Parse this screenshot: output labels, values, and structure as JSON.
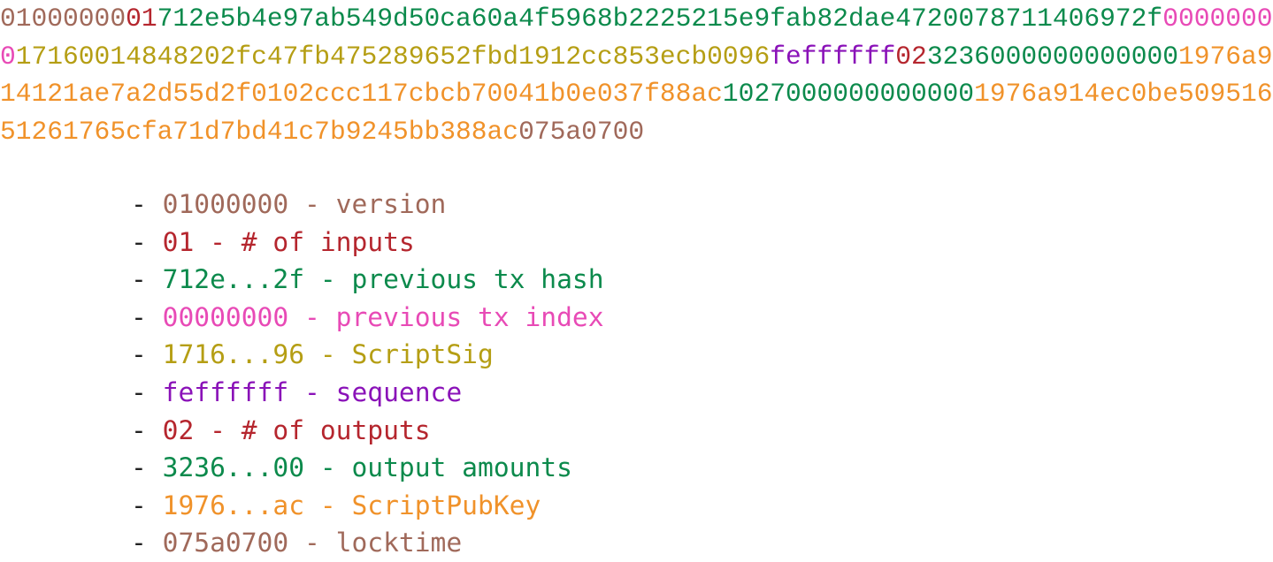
{
  "colors": {
    "version": "#a0695a",
    "input_count": "#b5262e",
    "prev_hash": "#0c8a4c",
    "prev_index": "#e84ab6",
    "script_sig": "#b59e14",
    "sequence": "#8a12b8",
    "output_count": "#b5262e",
    "output_amounts": "#0c8a4c",
    "script_pubkey": "#f0922a",
    "locktime": "#a0695a",
    "bullet": "#222222"
  },
  "hex_lines": [
    [
      {
        "text": "01000000",
        "role": "version"
      },
      {
        "text": "01",
        "role": "input_count"
      },
      {
        "text": "712e5b4e97ab549d50ca60a4f5968b2225215e9fab82dae4720078711406972f",
        "role": "prev_hash"
      },
      {
        "text": "0000000",
        "role": "prev_index"
      }
    ],
    [
      {
        "text": "0",
        "role": "prev_index"
      },
      {
        "text": "171600148482 02fc47fb475289652fbd1912cc853ecb0096",
        "role": "script_sig"
      },
      {
        "text": "feffffff",
        "role": "sequence"
      },
      {
        "text": "02",
        "role": "output_count"
      },
      {
        "text": "3236000000000000",
        "role": "output_amounts"
      },
      {
        "text": "1976a9",
        "role": "script_pubkey"
      }
    ],
    [
      {
        "text": "14121ae7a2d55d2f0102ccc117cbcb70041b0e037f88ac",
        "role": "script_pubkey"
      },
      {
        "text": "1027000000000000",
        "role": "output_amounts"
      },
      {
        "text": "1976a914ec0be509516",
        "role": "script_pubkey"
      }
    ],
    [
      {
        "text": "51261765cfa71d7bd41c7b9245bb388ac",
        "role": "script_pubkey"
      },
      {
        "text": "075a0700",
        "role": "locktime"
      }
    ]
  ],
  "legend": [
    {
      "bullet": "-",
      "value": "01000000",
      "sep": " - ",
      "label": "version",
      "role": "version"
    },
    {
      "bullet": "-",
      "value": "01",
      "sep": " - ",
      "label": "# of inputs",
      "role": "input_count"
    },
    {
      "bullet": "-",
      "value": "712e...2f",
      "sep": " - ",
      "label": "previous tx hash",
      "role": "prev_hash"
    },
    {
      "bullet": "-",
      "value": "00000000",
      "sep": " - ",
      "label": "previous tx index",
      "role": "prev_index"
    },
    {
      "bullet": "-",
      "value": "1716...96",
      "sep": " - ",
      "label": "ScriptSig",
      "role": "script_sig"
    },
    {
      "bullet": "-",
      "value": "feffffff",
      "sep": " - ",
      "label": "sequence",
      "role": "sequence"
    },
    {
      "bullet": "-",
      "value": "02",
      "sep": " - ",
      "label": "# of outputs",
      "role": "output_count"
    },
    {
      "bullet": "-",
      "value": "3236...00",
      "sep": " - ",
      "label": "output amounts",
      "role": "output_amounts"
    },
    {
      "bullet": "-",
      "value": "1976...ac",
      "sep": " - ",
      "label": "ScriptPubKey",
      "role": "script_pubkey"
    },
    {
      "bullet": "-",
      "value": "075a0700",
      "sep": " - ",
      "label": "locktime",
      "role": "locktime"
    }
  ]
}
